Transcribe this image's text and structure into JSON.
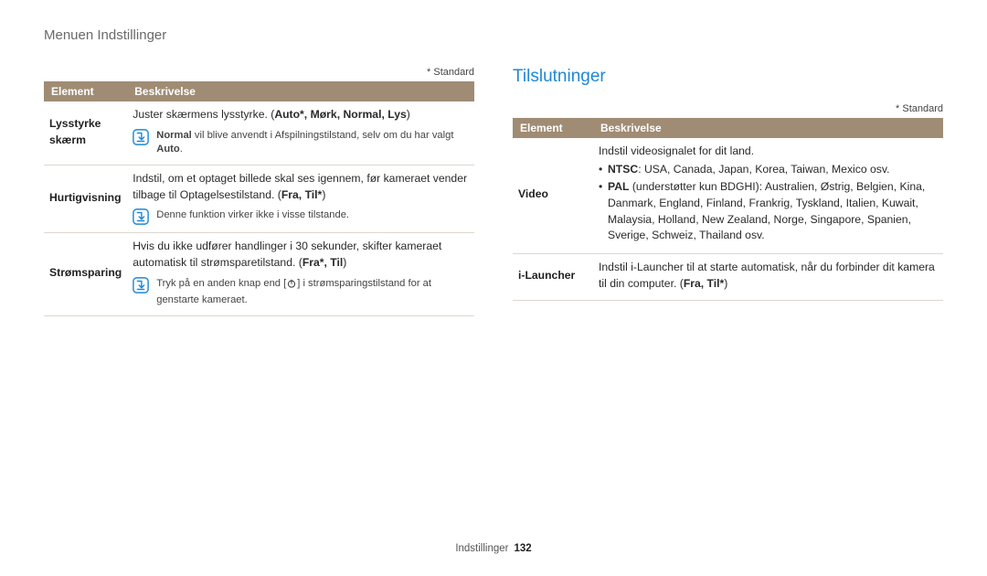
{
  "pageTitle": "Menuen Indstillinger",
  "standardNote": "* Standard",
  "headers": {
    "element": "Element",
    "desc": "Beskrivelse"
  },
  "left": {
    "rows": [
      {
        "element": "Lysstyrke skærm",
        "main_pre": "Juster skærmens lysstyrke. (",
        "main_bold": "Auto*, Mørk, Normal, Lys",
        "main_post": ")",
        "note_b": "Normal",
        "note_rest": " vil blive anvendt i Afspilningstilstand, selv om du har valgt ",
        "note_b2": "Auto",
        "note_tail": "."
      },
      {
        "element": "Hurtigvisning",
        "main_pre": "Indstil, om et optaget billede skal ses igennem, før kameraet vender tilbage til Optagelsestilstand. (",
        "main_bold": "Fra, Til*",
        "main_post": ")",
        "note_plain": "Denne funktion virker ikke i visse tilstande."
      },
      {
        "element": "Strømsparing",
        "main_pre": "Hvis du ikke udfører handlinger i 30 sekunder, skifter kameraet automatisk til strømsparetilstand. (",
        "main_bold": "Fra*, Til",
        "main_post": ")",
        "note_power_pre": "Tryk på en anden knap end [",
        "note_power_post": "] i strømsparingstilstand for at genstarte kameraet."
      }
    ]
  },
  "right": {
    "heading": "Tilslutninger",
    "rows": [
      {
        "element": "Video",
        "lead": "Indstil videosignalet for dit land.",
        "b1_label": "NTSC",
        "b1_text": ": USA, Canada, Japan, Korea, Taiwan, Mexico osv.",
        "b2_label": "PAL",
        "b2_paren": " (understøtter kun BDGHI): ",
        "b2_text": "Australien, Østrig, Belgien, Kina, Danmark, England, Finland, Frankrig, Tyskland, Italien, Kuwait, Malaysia, Holland, New Zealand, Norge, Singapore, Spanien, Sverige, Schweiz, Thailand osv."
      },
      {
        "element": "i-Launcher",
        "main_pre": "Indstil i-Launcher til at starte automatisk, når du forbinder dit kamera til din computer. (",
        "main_bold": "Fra, Til*",
        "main_post": ")"
      }
    ]
  },
  "footer": {
    "section": "Indstillinger",
    "page": "132"
  }
}
